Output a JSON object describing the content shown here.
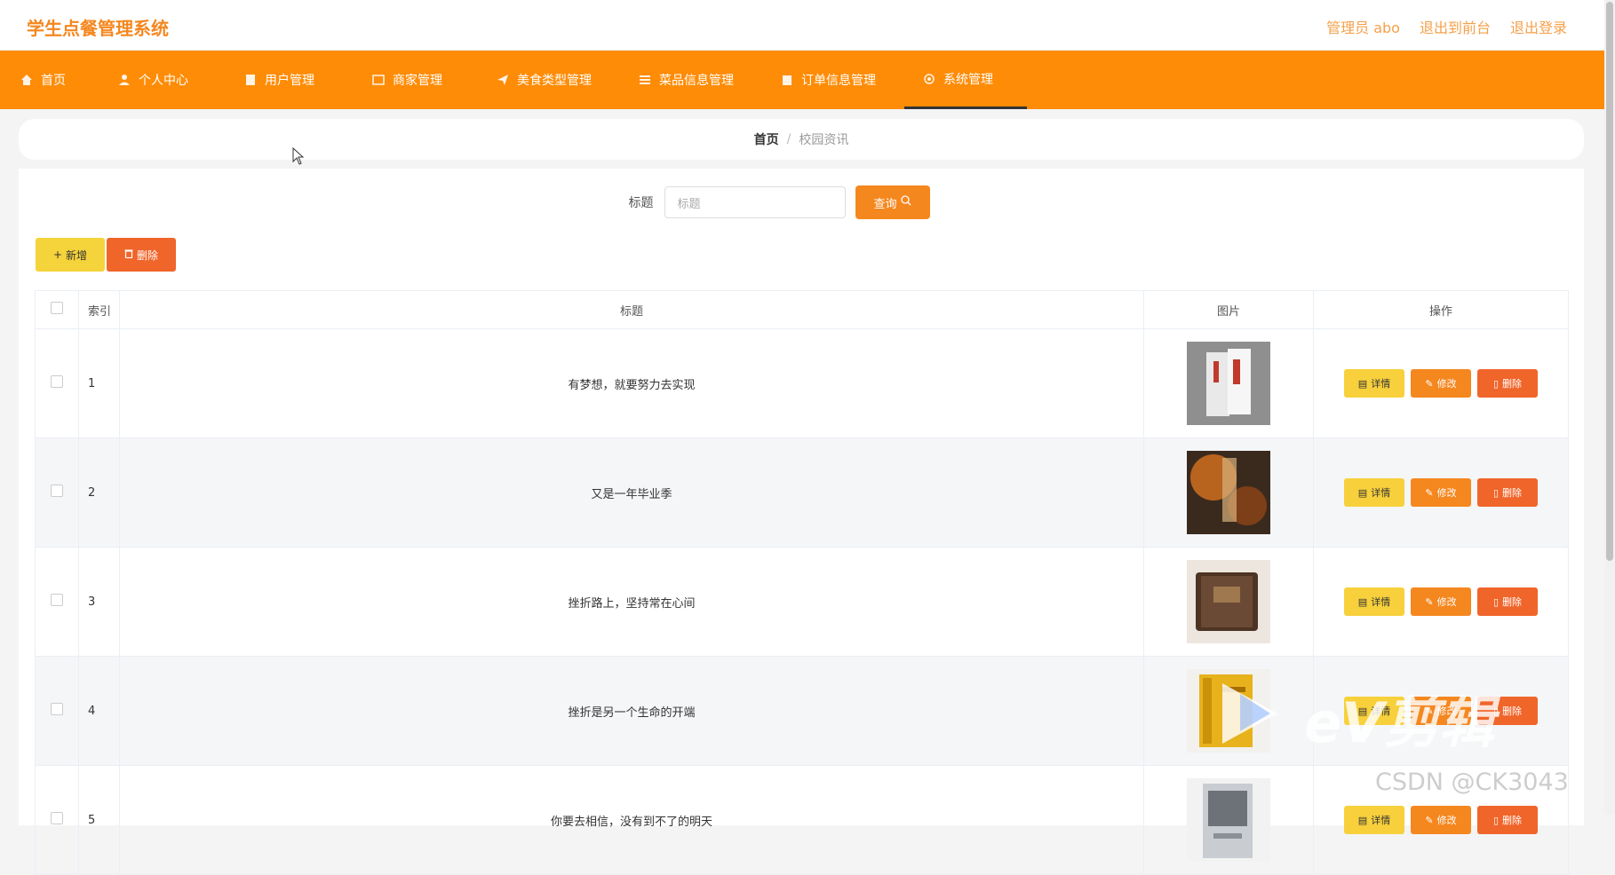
{
  "header": {
    "brand": "学生点餐管理系统",
    "user_label": "管理员 abo",
    "front_label": "退出到前台",
    "logout_label": "退出登录"
  },
  "nav": [
    {
      "label": "首页",
      "icon": "home-icon"
    },
    {
      "label": "个人中心",
      "icon": "user-icon"
    },
    {
      "label": "用户管理",
      "icon": "doc-icon"
    },
    {
      "label": "商家管理",
      "icon": "shop-icon"
    },
    {
      "label": "美食类型管理",
      "icon": "send-icon"
    },
    {
      "label": "菜品信息管理",
      "icon": "list-icon"
    },
    {
      "label": "订单信息管理",
      "icon": "clipboard-icon"
    },
    {
      "label": "系统管理",
      "icon": "gear-icon"
    }
  ],
  "nav_active": "系统管理",
  "breadcrumb": {
    "home": "首页",
    "separator": "/",
    "current": "校园资讯"
  },
  "search": {
    "label": "标题",
    "placeholder": "标题",
    "button": "查询"
  },
  "actions": {
    "add": "新增",
    "delete": "删除"
  },
  "table": {
    "headers": {
      "index": "索引",
      "title": "标题",
      "image": "图片",
      "ops": "操作"
    },
    "rows": [
      {
        "index": "1",
        "title": "有梦想，就要努力去实现",
        "image": "book-cover-1"
      },
      {
        "index": "2",
        "title": "又是一年毕业季",
        "image": "book-cover-2"
      },
      {
        "index": "3",
        "title": "挫折路上，坚持常在心间",
        "image": "book-cover-3"
      },
      {
        "index": "4",
        "title": "挫折是另一个生命的开端",
        "image": "book-cover-4"
      },
      {
        "index": "5",
        "title": "你要去相信，没有到不了的明天",
        "image": "book-cover-5"
      }
    ],
    "row_actions": {
      "detail": "详情",
      "edit": "修改",
      "delete": "删除"
    }
  },
  "overlays": {
    "watermark_text": "eV剪辑",
    "csdn": "CSDN @CK3043"
  },
  "colors": {
    "brand": "#f5871f",
    "nav_bg": "#ff8c06",
    "detail": "#f7d03c",
    "edit": "#f5871f",
    "delete": "#f0652a",
    "add": "#f5d33b"
  }
}
